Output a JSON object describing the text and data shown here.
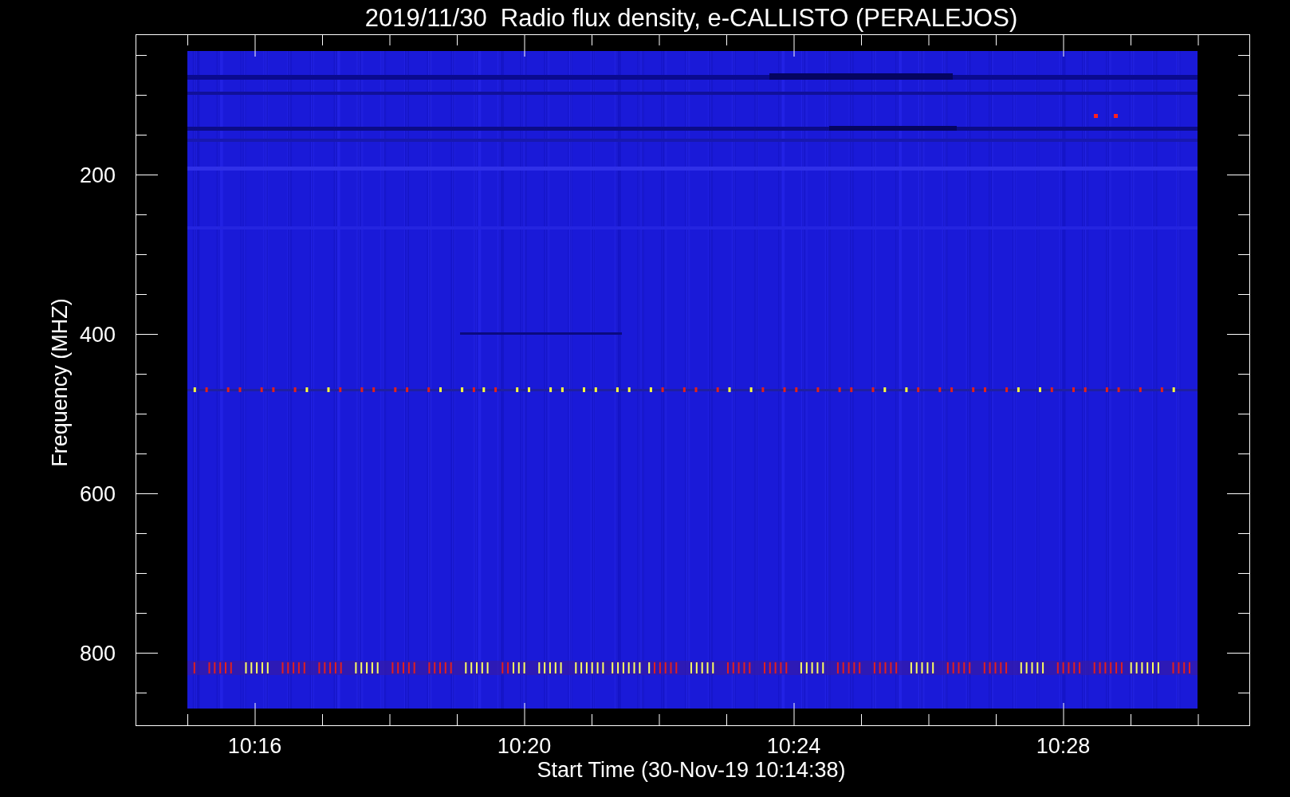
{
  "title": "2019/11/30  Radio flux density, e-CALLISTO (PERALEJOS)",
  "y_axis": {
    "label": "Frequency (MHZ)",
    "ticks": [
      "200",
      "400",
      "600",
      "800"
    ]
  },
  "x_axis": {
    "label": "Start Time (30-Nov-19 10:14:38)",
    "ticks": [
      "10:16",
      "10:20",
      "10:24",
      "10:28"
    ]
  }
}
